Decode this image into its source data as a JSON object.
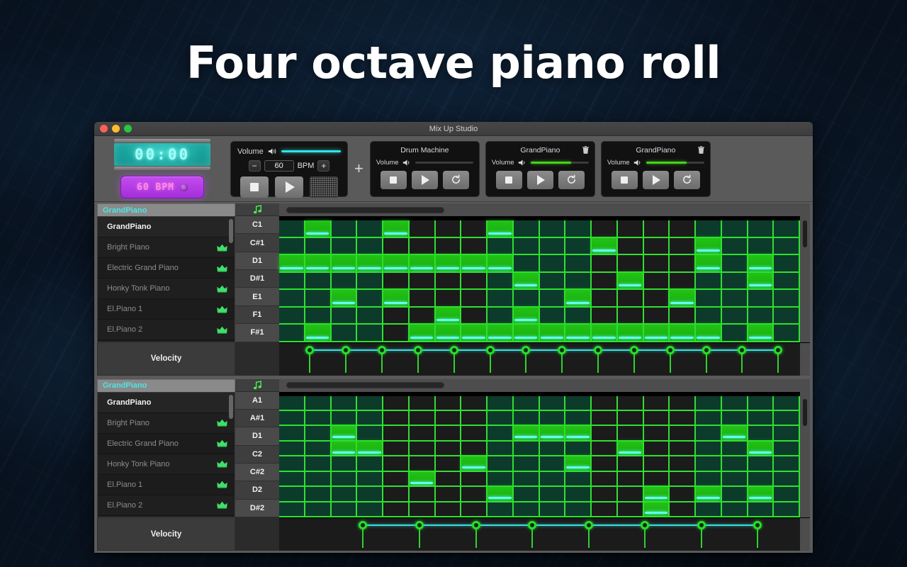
{
  "headline": "Four octave piano roll",
  "window": {
    "title": "Mix Up Studio",
    "traffic_lights": [
      "close",
      "minimize",
      "maximize"
    ]
  },
  "toolbar": {
    "lcd_time": "00:00",
    "bpm_button_label": "60 BPM",
    "master": {
      "volume_label": "Volume",
      "volume_icon": "speaker-icon",
      "volume_percent": 100,
      "volume_color": "#2fe4ea",
      "bpm_minus": "−",
      "bpm_value": "60",
      "bpm_unit": "BPM",
      "bpm_plus": "+",
      "stop_label": "stop-icon",
      "play_label": "play-icon",
      "metronome_label": "metronome-grill"
    },
    "add_track_label": "+",
    "tracks": [
      {
        "name": "Drum Machine",
        "volume_label": "Volume",
        "volume_percent": 0,
        "volume_color": "#3a3a3a",
        "has_delete": false,
        "buttons": [
          "stop-icon",
          "play-icon",
          "loop-icon"
        ]
      },
      {
        "name": "GrandPiano",
        "volume_label": "Volume",
        "volume_percent": 70,
        "volume_color": "#45d21a",
        "has_delete": true,
        "buttons": [
          "stop-icon",
          "play-icon",
          "loop-icon"
        ]
      },
      {
        "name": "GrandPiano",
        "volume_label": "Volume",
        "volume_percent": 70,
        "volume_color": "#45d21a",
        "has_delete": true,
        "buttons": [
          "stop-icon",
          "play-icon",
          "loop-icon"
        ]
      }
    ]
  },
  "instrument_list": {
    "items": [
      {
        "label": "GrandPiano",
        "premium": false,
        "selected": true
      },
      {
        "label": "Bright Piano",
        "premium": true,
        "selected": false
      },
      {
        "label": "Electric Grand Piano",
        "premium": true,
        "selected": false
      },
      {
        "label": "Honky Tonk Piano",
        "premium": true,
        "selected": false
      },
      {
        "label": "El.Piano 1",
        "premium": true,
        "selected": false
      },
      {
        "label": "El.Piano 2",
        "premium": true,
        "selected": false
      }
    ],
    "velocity_label": "Velocity"
  },
  "panels": [
    {
      "tab_label": "GrandPiano",
      "note_icon": "music-note-icon",
      "keys": [
        "C1",
        "C#1",
        "D1",
        "D#1",
        "E1",
        "F1",
        "F#1"
      ],
      "columns": 20,
      "grid": [
        [
          "lit",
          "on",
          "lit",
          "lit",
          "on",
          "dark",
          "dark",
          "dark",
          "on",
          "lit",
          "lit",
          "lit",
          "dark",
          "dark",
          "dark",
          "dark",
          "lit",
          "lit",
          "lit",
          "lit"
        ],
        [
          "lit",
          "lit",
          "lit",
          "lit",
          "dark",
          "dark",
          "dark",
          "dark",
          "lit",
          "lit",
          "lit",
          "lit",
          "on",
          "dark",
          "dark",
          "dark",
          "on",
          "lit",
          "lit",
          "lit"
        ],
        [
          "on",
          "on",
          "on",
          "on",
          "on",
          "on",
          "on",
          "on",
          "on",
          "lit",
          "lit",
          "lit",
          "dark",
          "dark",
          "dark",
          "dark",
          "on",
          "lit",
          "on",
          "lit"
        ],
        [
          "lit",
          "lit",
          "lit",
          "lit",
          "dark",
          "dark",
          "dark",
          "dark",
          "lit",
          "on",
          "lit",
          "lit",
          "dark",
          "on",
          "dark",
          "dark",
          "lit",
          "lit",
          "on",
          "lit"
        ],
        [
          "lit",
          "lit",
          "on",
          "lit",
          "on",
          "dark",
          "dark",
          "dark",
          "lit",
          "lit",
          "lit",
          "on",
          "dark",
          "dark",
          "dark",
          "on",
          "lit",
          "lit",
          "lit",
          "lit"
        ],
        [
          "lit",
          "lit",
          "lit",
          "lit",
          "dark",
          "dark",
          "on",
          "dark",
          "lit",
          "on",
          "lit",
          "lit",
          "dark",
          "dark",
          "dark",
          "dark",
          "lit",
          "lit",
          "lit",
          "lit"
        ],
        [
          "lit",
          "on",
          "lit",
          "lit",
          "dark",
          "on",
          "on",
          "on",
          "on",
          "on",
          "on",
          "on",
          "on",
          "on",
          "on",
          "on",
          "on",
          "lit",
          "on",
          "lit"
        ]
      ],
      "velocity_points": [
        2,
        4,
        6,
        8,
        10,
        11,
        12,
        13,
        14,
        15,
        16,
        17,
        18,
        19
      ],
      "velocity_first_col": 1,
      "velocity_count": 14,
      "hscroll_start_pct": 1,
      "hscroll_width_pct": 30,
      "vscroll_top_pct": 3,
      "vscroll_height_pct": 22
    },
    {
      "tab_label": "GrandPiano",
      "note_icon": "music-note-icon",
      "keys": [
        "A1",
        "A#1",
        "D1",
        "C2",
        "C#2",
        "D2",
        "D#2"
      ],
      "columns": 20,
      "grid": [
        [
          "lit",
          "lit",
          "lit",
          "lit",
          "dark",
          "dark",
          "dark",
          "dark",
          "lit",
          "lit",
          "lit",
          "lit",
          "dark",
          "dark",
          "dark",
          "dark",
          "lit",
          "lit",
          "lit",
          "lit"
        ],
        [
          "lit",
          "lit",
          "lit",
          "lit",
          "dark",
          "dark",
          "dark",
          "dark",
          "lit",
          "lit",
          "lit",
          "lit",
          "dark",
          "dark",
          "dark",
          "dark",
          "lit",
          "lit",
          "lit",
          "lit"
        ],
        [
          "lit",
          "lit",
          "on",
          "lit",
          "dark",
          "dark",
          "dark",
          "dark",
          "lit",
          "on",
          "on",
          "on",
          "dark",
          "dark",
          "dark",
          "dark",
          "lit",
          "on",
          "lit",
          "lit"
        ],
        [
          "lit",
          "lit",
          "on",
          "on",
          "dark",
          "dark",
          "dark",
          "dark",
          "lit",
          "lit",
          "lit",
          "lit",
          "dark",
          "on",
          "dark",
          "dark",
          "lit",
          "lit",
          "on",
          "lit"
        ],
        [
          "lit",
          "lit",
          "lit",
          "lit",
          "dark",
          "dark",
          "dark",
          "on",
          "lit",
          "lit",
          "lit",
          "on",
          "dark",
          "dark",
          "dark",
          "dark",
          "lit",
          "lit",
          "lit",
          "lit"
        ],
        [
          "lit",
          "lit",
          "lit",
          "lit",
          "dark",
          "on",
          "dark",
          "dark",
          "lit",
          "lit",
          "lit",
          "lit",
          "dark",
          "dark",
          "dark",
          "dark",
          "lit",
          "lit",
          "lit",
          "lit"
        ],
        [
          "lit",
          "lit",
          "lit",
          "lit",
          "dark",
          "dark",
          "dark",
          "dark",
          "on",
          "lit",
          "lit",
          "lit",
          "dark",
          "dark",
          "on",
          "dark",
          "on",
          "lit",
          "on",
          "lit"
        ],
        [
          "lit",
          "lit",
          "lit",
          "lit",
          "dark",
          "dark",
          "dark",
          "dark",
          "lit",
          "lit",
          "lit",
          "lit",
          "dark",
          "dark",
          "on",
          "dark",
          "lit",
          "lit",
          "lit",
          "lit"
        ]
      ],
      "velocity_points": [
        3,
        5,
        8,
        11,
        13,
        15,
        17,
        19
      ],
      "velocity_first_col": 3,
      "velocity_count": 8,
      "hscroll_start_pct": 1,
      "hscroll_width_pct": 30,
      "vscroll_top_pct": 34,
      "vscroll_height_pct": 22
    }
  ],
  "colors": {
    "grid_line": "#2fe02f",
    "note_fill": "#21c315",
    "note_marker": "#62fff0",
    "cell_lit": "#0c3b2b",
    "cell_dark": "#1b1b1b",
    "tab_text": "#4de4e4",
    "lcd": "#9ffff9",
    "bpm_button": "#c44df0"
  }
}
